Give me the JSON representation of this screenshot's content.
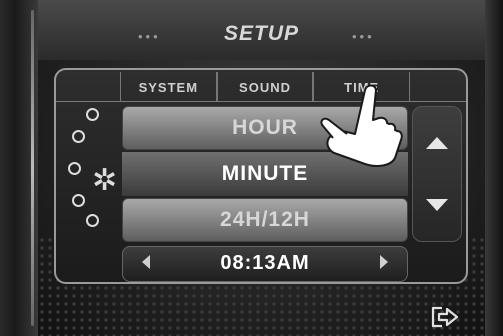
{
  "header": {
    "title": "SETUP",
    "dots_left": "•••",
    "dots_right": "•••"
  },
  "tabs": [
    {
      "label": "SYSTEM"
    },
    {
      "label": "SOUND"
    },
    {
      "label": "TIME"
    }
  ],
  "menu": {
    "items": [
      {
        "label": "HOUR"
      },
      {
        "label": "MINUTE"
      },
      {
        "label": "24H/12H"
      }
    ],
    "selected": "MINUTE"
  },
  "time_setting": {
    "value": "08:13AM"
  },
  "icons": {
    "settings": "gear-icon",
    "scroll_up": "triangle-up-icon",
    "scroll_down": "triangle-down-icon",
    "prev": "chevron-left-icon",
    "next": "chevron-right-icon",
    "exit": "exit-arrow-icon",
    "pointer": "hand-pointer-icon"
  },
  "colors": {
    "text_selected": "#ffffff",
    "text_normal": "#d7d7d7",
    "panel_border": "#9a9a9a"
  }
}
